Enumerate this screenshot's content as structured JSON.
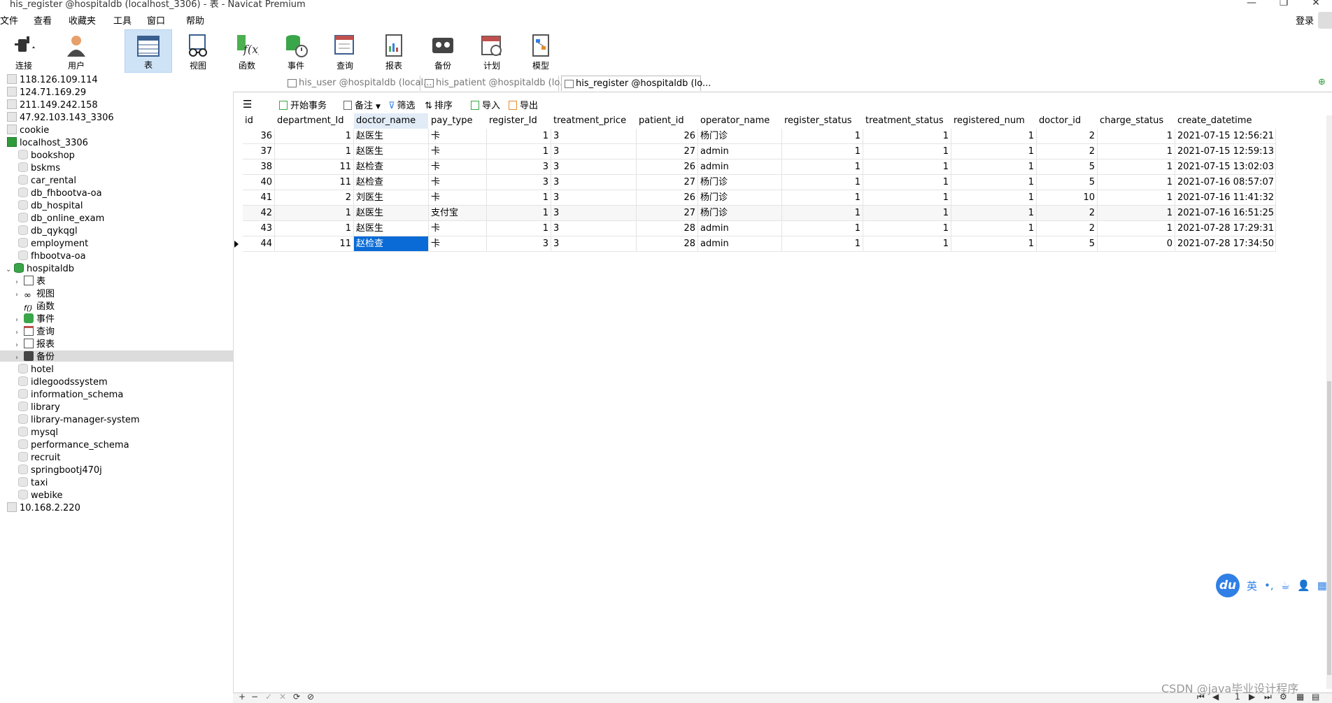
{
  "window": {
    "title": "his_register @hospitaldb (localhost_3306) - 表 - Navicat Premium",
    "controls": [
      "—",
      "❐",
      "✕"
    ]
  },
  "menu": {
    "items": [
      "文件",
      "查看",
      "收藏夹",
      "工具",
      "窗口",
      "帮助"
    ],
    "login": "登录"
  },
  "toolbar": {
    "buttons": [
      {
        "label": "连接",
        "icon": "plug-icon"
      },
      {
        "label": "用户",
        "icon": "user-icon"
      },
      {
        "label": "表",
        "icon": "table-icon",
        "active": true
      },
      {
        "label": "视图",
        "icon": "view-glasses-icon"
      },
      {
        "label": "函数",
        "icon": "function-icon"
      },
      {
        "label": "事件",
        "icon": "event-icon"
      },
      {
        "label": "查询",
        "icon": "query-icon"
      },
      {
        "label": "报表",
        "icon": "report-icon"
      },
      {
        "label": "备份",
        "icon": "backup-icon"
      },
      {
        "label": "计划",
        "icon": "schedule-icon"
      },
      {
        "label": "模型",
        "icon": "model-icon"
      }
    ]
  },
  "tree": {
    "servers_top": [
      "118.126.109.114",
      "124.71.169.29",
      "211.149.242.158",
      "47.92.103.143_3306",
      "cookie"
    ],
    "localhost": "localhost_3306",
    "dbs_before": [
      "bookshop",
      "bskms",
      "car_rental",
      "db_fhbootva-oa",
      "db_hospital",
      "db_online_exam",
      "db_qykqgl",
      "employment",
      "fhbootva-oa"
    ],
    "hospitaldb": "hospitaldb",
    "hospitaldb_children": [
      "表",
      "视图",
      "函数",
      "事件",
      "查询",
      "报表",
      "备份"
    ],
    "dbs_after": [
      "hotel",
      "idlegoodssystem",
      "information_schema",
      "library",
      "library-manager-system",
      "mysql",
      "performance_schema",
      "recruit",
      "springbootj470j",
      "taxi",
      "webike"
    ],
    "server_bottom": "10.168.2.220"
  },
  "tabs": [
    {
      "label": "his_user @hospitaldb (local..."
    },
    {
      "label": "his_patient @hospitaldb (lo..."
    },
    {
      "label": "his_register @hospitaldb (lo..."
    }
  ],
  "table_toolbar": {
    "begin_tx": "开始事务",
    "note": "备注",
    "filter": "筛选",
    "sort": "排序",
    "import": "导入",
    "export": "导出"
  },
  "grid": {
    "columns": [
      "id",
      "department_Id",
      "doctor_name",
      "pay_type",
      "register_Id",
      "treatment_price",
      "patient_id",
      "operator_name",
      "register_status",
      "treatment_status",
      "registered_num",
      "doctor_id",
      "charge_status",
      "create_datetime"
    ],
    "rows": [
      [
        "36",
        "1",
        "赵医生",
        "卡",
        "1",
        "3",
        "26",
        "杨门诊",
        "1",
        "1",
        "1",
        "2",
        "1",
        "2021-07-15 12:56:21"
      ],
      [
        "37",
        "1",
        "赵医生",
        "卡",
        "1",
        "3",
        "27",
        "admin",
        "1",
        "1",
        "1",
        "2",
        "1",
        "2021-07-15 12:59:13"
      ],
      [
        "38",
        "11",
        "赵检查",
        "卡",
        "3",
        "3",
        "26",
        "admin",
        "1",
        "1",
        "1",
        "5",
        "1",
        "2021-07-15 13:02:03"
      ],
      [
        "40",
        "11",
        "赵检查",
        "卡",
        "3",
        "3",
        "27",
        "杨门诊",
        "1",
        "1",
        "1",
        "5",
        "1",
        "2021-07-16 08:57:07"
      ],
      [
        "41",
        "2",
        "刘医生",
        "卡",
        "1",
        "3",
        "26",
        "杨门诊",
        "1",
        "1",
        "1",
        "10",
        "1",
        "2021-07-16 11:41:32"
      ],
      [
        "42",
        "1",
        "赵医生",
        "支付宝",
        "1",
        "3",
        "27",
        "杨门诊",
        "1",
        "1",
        "1",
        "2",
        "1",
        "2021-07-16 16:51:25"
      ],
      [
        "43",
        "1",
        "赵医生",
        "卡",
        "1",
        "3",
        "28",
        "admin",
        "1",
        "1",
        "1",
        "2",
        "1",
        "2021-07-28 17:29:31"
      ],
      [
        "44",
        "11",
        "赵检查",
        "卡",
        "3",
        "3",
        "28",
        "admin",
        "1",
        "1",
        "1",
        "5",
        "0",
        "2021-07-28 17:34:50"
      ]
    ]
  },
  "ime": {
    "logo": "du",
    "lang": "英",
    "punct": "•,",
    "cup": "☕",
    "person": "👤",
    "grid": "▦"
  },
  "watermark": "CSDN @java毕业设计程序",
  "bottom": {
    "add": "+",
    "remove": "−",
    "check": "✓",
    "cancel": "✕",
    "refresh": "⟳",
    "stop": "⊘",
    "page": "1"
  }
}
